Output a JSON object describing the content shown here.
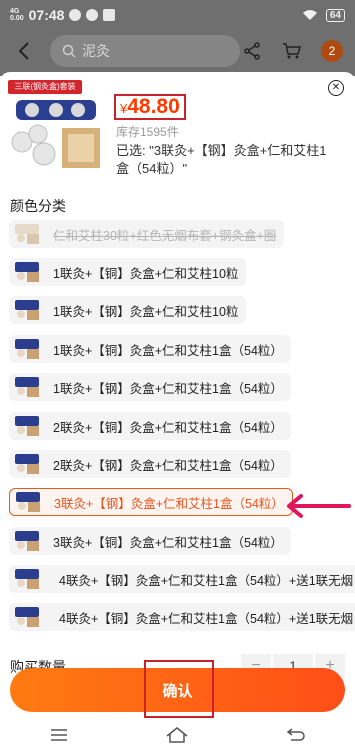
{
  "status_bar": {
    "network": "4G",
    "network_speed": "0.00",
    "time": "07:48",
    "battery": "64"
  },
  "nav": {
    "search_placeholder": "泥灸",
    "cart_badge": "2"
  },
  "product": {
    "image_banner": "三联(钢灸盒)套装",
    "price_symbol": "¥",
    "price": "48.80",
    "stock": "库存1595件",
    "selected_text": "已选: \"3联灸+【钢】灸盒+仁和艾柱1盒（54粒）\""
  },
  "section_title": "颜色分类",
  "options": [
    {
      "label": "仁和艾柱30粒+红色无烟布套+钢灸盒+圈",
      "state": "disabled"
    },
    {
      "label": "1联灸+【铜】灸盒+仁和艾柱10粒",
      "state": "normal"
    },
    {
      "label": "1联灸+【钢】灸盒+仁和艾柱10粒",
      "state": "normal"
    },
    {
      "label": "1联灸+【铜】灸盒+仁和艾柱1盒（54粒）",
      "state": "normal"
    },
    {
      "label": "1联灸+【钢】灸盒+仁和艾柱1盒（54粒）",
      "state": "normal"
    },
    {
      "label": "2联灸+【铜】灸盒+仁和艾柱1盒（54粒）",
      "state": "normal"
    },
    {
      "label": "2联灸+【钢】灸盒+仁和艾柱1盒（54粒）",
      "state": "normal"
    },
    {
      "label": "3联灸+【钢】灸盒+仁和艾柱1盒（54粒）",
      "state": "selected"
    },
    {
      "label": "3联灸+【铜】灸盒+仁和艾柱1盒（54粒）",
      "state": "normal"
    },
    {
      "label": "4联灸+【钢】灸盒+仁和艾柱1盒（54粒）+送1联无烟",
      "state": "normal"
    },
    {
      "label": "4联灸+【铜】灸盒+仁和艾柱1盒（54粒）+送1联无烟",
      "state": "normal"
    }
  ],
  "quantity": {
    "label": "购买数量",
    "minus": "−",
    "value": "1",
    "plus": "+"
  },
  "confirm_label": "确认",
  "colors": {
    "accent": "#ff5a17",
    "selected_text": "#e8541d",
    "annotation": "#c8222a",
    "price": "#ff3b00"
  }
}
